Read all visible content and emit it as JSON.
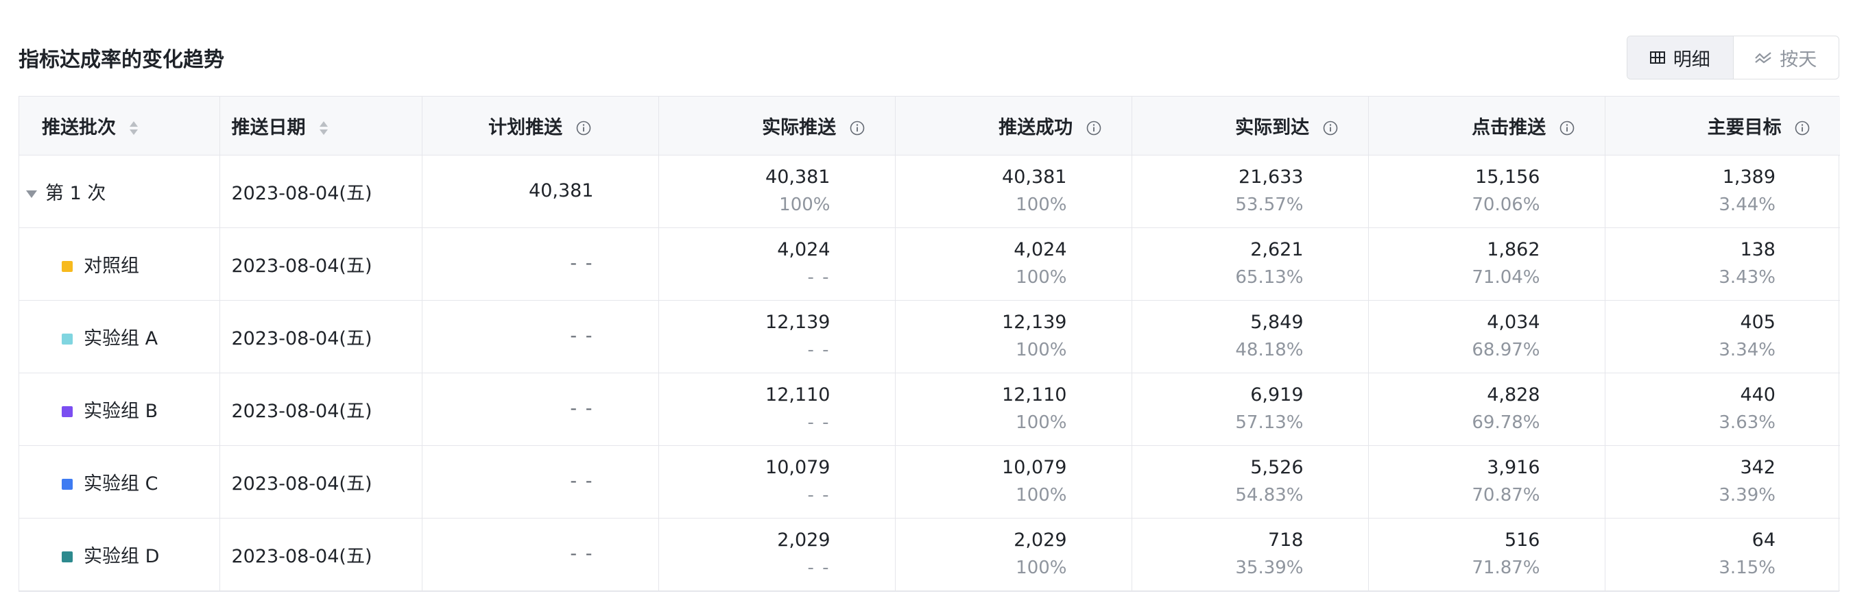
{
  "title": "指标达成率的变化趋势",
  "toggle": {
    "detail_label": "明细",
    "byday_label": "按天",
    "active": "明细"
  },
  "columns": [
    "推送批次",
    "推送日期",
    "计划推送",
    "实际推送",
    "推送成功",
    "实际到达",
    "点击推送",
    "主要目标"
  ],
  "rows": [
    {
      "name": "第 1 次",
      "color": "",
      "date": "2023-08-04(五)",
      "plan": "40,381",
      "actual": "40,381",
      "actual_pct": "100%",
      "success": "40,381",
      "success_pct": "100%",
      "arrive": "21,633",
      "arrive_pct": "53.57%",
      "click": "15,156",
      "click_pct": "70.06%",
      "goal": "1,389",
      "goal_pct": "3.44%"
    },
    {
      "name": "对照组",
      "color": "#f7ba1e",
      "date": "2023-08-04(五)",
      "plan": "- -",
      "actual": "4,024",
      "actual_pct": "- -",
      "success": "4,024",
      "success_pct": "100%",
      "arrive": "2,621",
      "arrive_pct": "65.13%",
      "click": "1,862",
      "click_pct": "71.04%",
      "goal": "138",
      "goal_pct": "3.43%"
    },
    {
      "name": "实验组 A",
      "color": "#80d5e0",
      "date": "2023-08-04(五)",
      "plan": "- -",
      "actual": "12,139",
      "actual_pct": "- -",
      "success": "12,139",
      "success_pct": "100%",
      "arrive": "5,849",
      "arrive_pct": "48.18%",
      "click": "4,034",
      "click_pct": "68.97%",
      "goal": "405",
      "goal_pct": "3.34%"
    },
    {
      "name": "实验组 B",
      "color": "#7b4ef1",
      "date": "2023-08-04(五)",
      "plan": "- -",
      "actual": "12,110",
      "actual_pct": "- -",
      "success": "12,110",
      "success_pct": "100%",
      "arrive": "6,919",
      "arrive_pct": "57.13%",
      "click": "4,828",
      "click_pct": "69.78%",
      "goal": "440",
      "goal_pct": "3.63%"
    },
    {
      "name": "实验组 C",
      "color": "#3e7bf2",
      "date": "2023-08-04(五)",
      "plan": "- -",
      "actual": "10,079",
      "actual_pct": "- -",
      "success": "10,079",
      "success_pct": "100%",
      "arrive": "5,526",
      "arrive_pct": "54.83%",
      "click": "3,916",
      "click_pct": "70.87%",
      "goal": "342",
      "goal_pct": "3.39%"
    },
    {
      "name": "实验组 D",
      "color": "#2d8a8e",
      "date": "2023-08-04(五)",
      "plan": "- -",
      "actual": "2,029",
      "actual_pct": "- -",
      "success": "2,029",
      "success_pct": "100%",
      "arrive": "718",
      "arrive_pct": "35.39%",
      "click": "516",
      "click_pct": "71.87%",
      "goal": "64",
      "goal_pct": "3.15%"
    }
  ]
}
